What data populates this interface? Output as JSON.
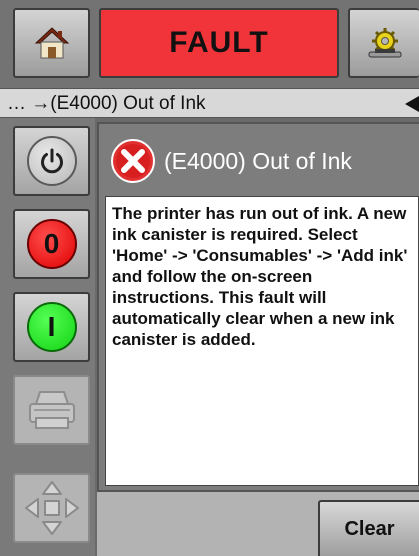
{
  "header": {
    "home_icon": "home-icon",
    "fault_label": "FAULT",
    "service_icon": "service-tools-icon"
  },
  "status_bar": {
    "text": "… →(E4000) Out of Ink"
  },
  "side_buttons": [
    {
      "name": "power-button",
      "icon": "power-icon"
    },
    {
      "name": "stop-button",
      "label": "0",
      "color": "#e00000"
    },
    {
      "name": "start-button",
      "label": "I",
      "color": "#12d212"
    },
    {
      "name": "print-button",
      "icon": "printer-icon",
      "state": "disabled"
    },
    {
      "name": "navigation-button",
      "icon": "arrows-icon",
      "state": "disabled"
    }
  ],
  "fault": {
    "icon": "error-icon",
    "title": "(E4000) Out of Ink",
    "message": "The printer has run out of ink.  A new ink canister is required.  Select 'Home' -> 'Consumables' -> 'Add ink' and follow the on-screen instructions.  This fault will automatically clear when a new ink canister is added."
  },
  "footer": {
    "clear_label": "Clear"
  }
}
